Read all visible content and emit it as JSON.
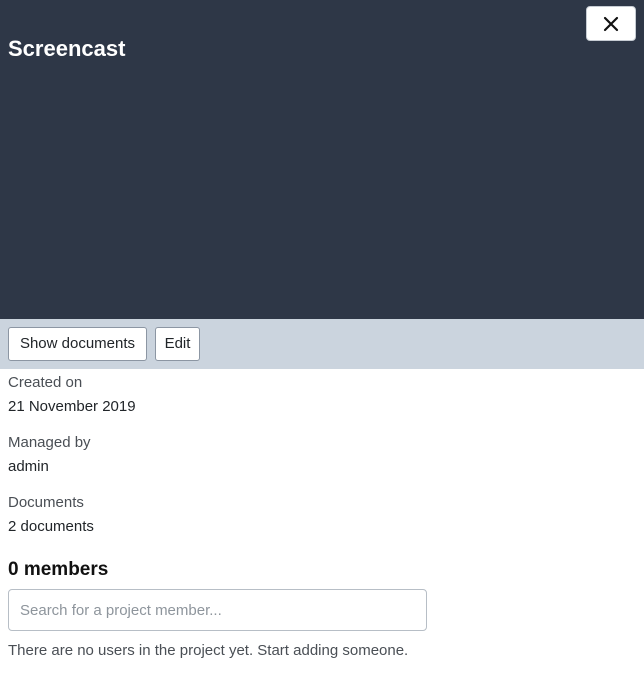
{
  "header": {
    "title": "Screencast",
    "close_icon": "close-icon"
  },
  "toolbar": {
    "show_documents_label": "Show documents",
    "edit_label": "Edit"
  },
  "details": {
    "created_label": "Created on",
    "created_value": "21 November 2019",
    "managed_label": "Managed by",
    "managed_value": "admin",
    "documents_label": "Documents",
    "documents_value": "2 documents"
  },
  "members": {
    "heading": "0 members",
    "search_placeholder": "Search for a project member...",
    "empty_message": "There are no users in the project yet. Start adding someone."
  },
  "colors": {
    "header_bg": "#2e3747",
    "toolbar_bg": "#cbd4de"
  }
}
